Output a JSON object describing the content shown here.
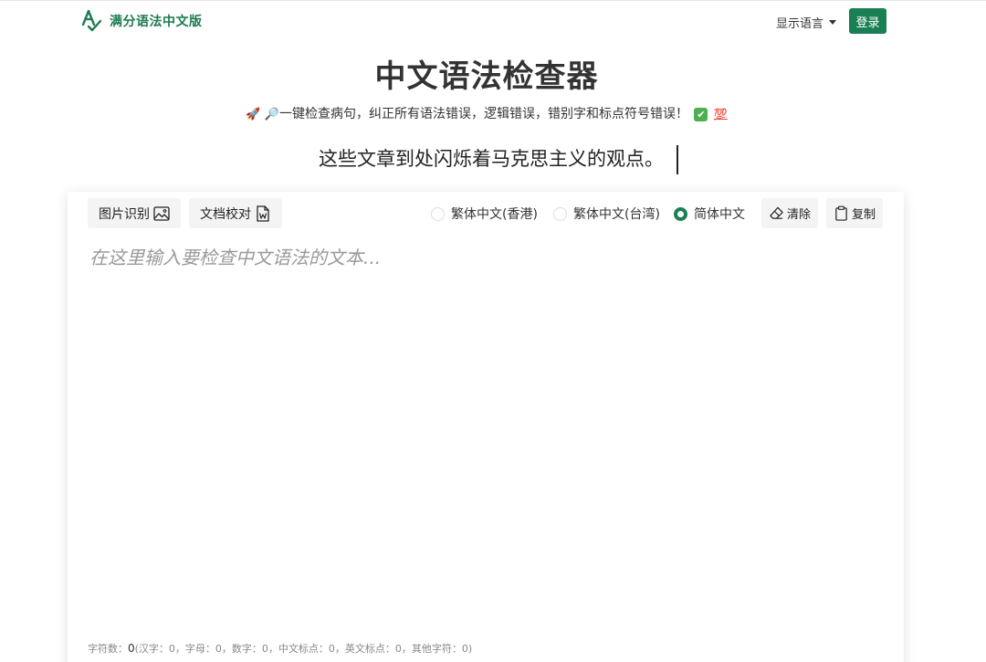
{
  "header": {
    "brand": "满分语法中文版",
    "language_menu": "显示语言",
    "login": "登录"
  },
  "hero": {
    "title": "中文语法检查器",
    "tagline": "一键检查病句，纠正所有语法错误，逻辑错误，错别字和标点符号错误！",
    "typing_example": "这些文章到处闪烁着马克思主义的观点。"
  },
  "toolbar": {
    "image_ocr": "图片识别",
    "doc_check": "文档校对",
    "radios": [
      {
        "label": "繁体中文(香港)",
        "checked": false
      },
      {
        "label": "繁体中文(台湾)",
        "checked": false
      },
      {
        "label": "简体中文",
        "checked": true
      }
    ],
    "clear": "清除",
    "copy": "复制"
  },
  "editor": {
    "placeholder": "在这里输入要检查中文语法的文本...",
    "value": ""
  },
  "stats": {
    "label": "字符数：",
    "count": "0",
    "detail": "(汉字：0，字母：0，数字：0，中文标点：0，英文标点：0，其他字符：0)"
  },
  "colors": {
    "brand_green": "#1a7f52",
    "placeholder_gray": "#9a9a9a"
  },
  "icons": [
    "rocket-icon",
    "magnifier-icon",
    "checkmark-emoji-icon",
    "hundred-points-icon",
    "image-icon",
    "word-doc-icon",
    "eraser-icon",
    "clipboard-icon",
    "caret-down-icon"
  ]
}
